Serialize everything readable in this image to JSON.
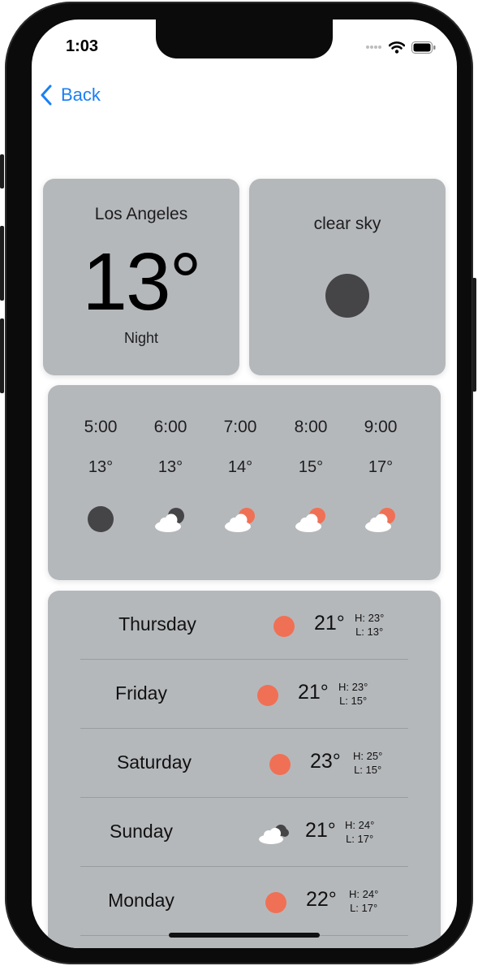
{
  "status_bar": {
    "time": "1:03"
  },
  "nav": {
    "back_label": "Back"
  },
  "current": {
    "city": "Los Angeles",
    "temperature": "13°",
    "period": "Night",
    "condition": "clear sky",
    "condition_icon": "moon-icon"
  },
  "hourly": [
    {
      "time": "5:00",
      "temp": "13°",
      "icon": "moon-icon"
    },
    {
      "time": "6:00",
      "temp": "13°",
      "icon": "cloud-moon-icon"
    },
    {
      "time": "7:00",
      "temp": "14°",
      "icon": "cloud-sun-icon"
    },
    {
      "time": "8:00",
      "temp": "15°",
      "icon": "cloud-sun-icon"
    },
    {
      "time": "9:00",
      "temp": "17°",
      "icon": "cloud-sun-icon"
    }
  ],
  "daily": [
    {
      "day": "Thursday",
      "icon": "sun-icon",
      "temp": "21°",
      "high": "H: 23°",
      "low": "L: 13°"
    },
    {
      "day": "Friday",
      "icon": "sun-icon",
      "temp": "21°",
      "high": "H: 23°",
      "low": "L: 15°"
    },
    {
      "day": "Saturday",
      "icon": "sun-icon",
      "temp": "23°",
      "high": "H: 25°",
      "low": "L: 15°"
    },
    {
      "day": "Sunday",
      "icon": "clouds-icon",
      "temp": "21°",
      "high": "H: 24°",
      "low": "L: 17°"
    },
    {
      "day": "Monday",
      "icon": "sun-icon",
      "temp": "22°",
      "high": "H: 24°",
      "low": "L: 17°"
    }
  ],
  "colors": {
    "accent": "#1a7ff5",
    "card": "#b5b8bb",
    "sun": "#f07055",
    "moon": "#454547",
    "cloud": "#ffffff"
  }
}
